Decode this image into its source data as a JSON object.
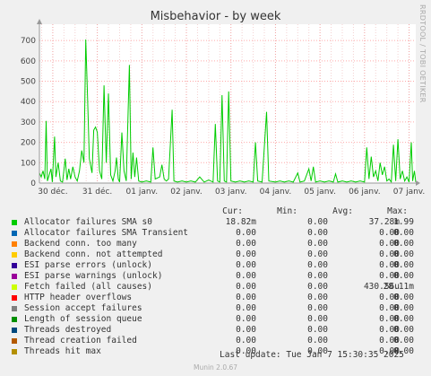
{
  "title": "Misbehavior - by week",
  "side_label": "RRDTOOL / TOBI OETIKER",
  "colors": {
    "series_line": "#00cc00",
    "grid": "#ffaaaa",
    "axis": "#999999"
  },
  "chart_data": {
    "type": "line",
    "title": "Misbehavior - by week",
    "ylim": [
      0,
      780
    ],
    "yticks": [
      0,
      100,
      200,
      300,
      400,
      500,
      600,
      700
    ],
    "xticks": [
      "30 déc.",
      "31 déc.",
      "01 janv.",
      "02 janv.",
      "03 janv.",
      "04 janv.",
      "05 janv.",
      "06 janv.",
      "07 janv."
    ],
    "xrange_days": [
      -0.3,
      8.15
    ],
    "grid": true,
    "series": [
      {
        "name": "Allocator failures SMA s0",
        "color": "#00cc00",
        "points": [
          [
            -0.3,
            50
          ],
          [
            -0.26,
            30
          ],
          [
            -0.22,
            60
          ],
          [
            -0.18,
            20
          ],
          [
            -0.15,
            305
          ],
          [
            -0.12,
            10
          ],
          [
            -0.08,
            40
          ],
          [
            -0.04,
            70
          ],
          [
            -0.01,
            5
          ],
          [
            0.04,
            228
          ],
          [
            0.07,
            30
          ],
          [
            0.12,
            100
          ],
          [
            0.17,
            10
          ],
          [
            0.22,
            5
          ],
          [
            0.28,
            120
          ],
          [
            0.32,
            15
          ],
          [
            0.36,
            70
          ],
          [
            0.4,
            20
          ],
          [
            0.45,
            80
          ],
          [
            0.5,
            30
          ],
          [
            0.55,
            10
          ],
          [
            0.6,
            60
          ],
          [
            0.65,
            160
          ],
          [
            0.7,
            100
          ],
          [
            0.74,
            705
          ],
          [
            0.78,
            425
          ],
          [
            0.82,
            120
          ],
          [
            0.88,
            50
          ],
          [
            0.92,
            260
          ],
          [
            0.96,
            275
          ],
          [
            1.0,
            250
          ],
          [
            1.05,
            60
          ],
          [
            1.1,
            20
          ],
          [
            1.15,
            480
          ],
          [
            1.2,
            100
          ],
          [
            1.25,
            440
          ],
          [
            1.3,
            40
          ],
          [
            1.35,
            10
          ],
          [
            1.4,
            60
          ],
          [
            1.43,
            125
          ],
          [
            1.47,
            20
          ],
          [
            1.5,
            5
          ],
          [
            1.55,
            248
          ],
          [
            1.6,
            60
          ],
          [
            1.65,
            10
          ],
          [
            1.72,
            580
          ],
          [
            1.76,
            20
          ],
          [
            1.8,
            150
          ],
          [
            1.84,
            30
          ],
          [
            1.88,
            125
          ],
          [
            1.93,
            10
          ],
          [
            2.0,
            5
          ],
          [
            2.1,
            10
          ],
          [
            2.2,
            5
          ],
          [
            2.25,
            175
          ],
          [
            2.3,
            20
          ],
          [
            2.4,
            30
          ],
          [
            2.45,
            90
          ],
          [
            2.5,
            20
          ],
          [
            2.55,
            10
          ],
          [
            2.6,
            20
          ],
          [
            2.68,
            360
          ],
          [
            2.72,
            10
          ],
          [
            2.8,
            5
          ],
          [
            2.9,
            10
          ],
          [
            3.0,
            5
          ],
          [
            3.1,
            10
          ],
          [
            3.2,
            5
          ],
          [
            3.3,
            30
          ],
          [
            3.4,
            5
          ],
          [
            3.5,
            15
          ],
          [
            3.6,
            5
          ],
          [
            3.65,
            290
          ],
          [
            3.7,
            10
          ],
          [
            3.75,
            5
          ],
          [
            3.8,
            432
          ],
          [
            3.85,
            10
          ],
          [
            3.9,
            5
          ],
          [
            3.95,
            450
          ],
          [
            4.0,
            10
          ],
          [
            4.1,
            5
          ],
          [
            4.2,
            10
          ],
          [
            4.3,
            5
          ],
          [
            4.4,
            10
          ],
          [
            4.5,
            5
          ],
          [
            4.55,
            200
          ],
          [
            4.6,
            10
          ],
          [
            4.7,
            5
          ],
          [
            4.8,
            350
          ],
          [
            4.85,
            10
          ],
          [
            5.0,
            5
          ],
          [
            5.1,
            10
          ],
          [
            5.2,
            5
          ],
          [
            5.3,
            10
          ],
          [
            5.4,
            5
          ],
          [
            5.5,
            50
          ],
          [
            5.55,
            5
          ],
          [
            5.65,
            10
          ],
          [
            5.75,
            70
          ],
          [
            5.8,
            10
          ],
          [
            5.85,
            80
          ],
          [
            5.9,
            5
          ],
          [
            6.0,
            10
          ],
          [
            6.1,
            5
          ],
          [
            6.2,
            10
          ],
          [
            6.3,
            5
          ],
          [
            6.35,
            45
          ],
          [
            6.4,
            5
          ],
          [
            6.5,
            10
          ],
          [
            6.6,
            5
          ],
          [
            6.7,
            10
          ],
          [
            6.8,
            5
          ],
          [
            6.9,
            10
          ],
          [
            7.0,
            5
          ],
          [
            7.05,
            175
          ],
          [
            7.1,
            20
          ],
          [
            7.15,
            130
          ],
          [
            7.2,
            30
          ],
          [
            7.25,
            60
          ],
          [
            7.3,
            10
          ],
          [
            7.35,
            100
          ],
          [
            7.4,
            40
          ],
          [
            7.45,
            80
          ],
          [
            7.5,
            10
          ],
          [
            7.55,
            20
          ],
          [
            7.6,
            5
          ],
          [
            7.65,
            188
          ],
          [
            7.7,
            10
          ],
          [
            7.75,
            215
          ],
          [
            7.8,
            20
          ],
          [
            7.85,
            60
          ],
          [
            7.9,
            10
          ],
          [
            7.95,
            30
          ],
          [
            8.0,
            5
          ],
          [
            8.05,
            200
          ],
          [
            8.08,
            10
          ],
          [
            8.12,
            60
          ],
          [
            8.15,
            5
          ]
        ]
      }
    ]
  },
  "legend": {
    "headers": {
      "cur": "Cur:",
      "min": "Min:",
      "avg": "Avg:",
      "max": "Max:"
    },
    "rows": [
      {
        "name": "Allocator failures SMA s0",
        "color": "#00cc00",
        "cur": "18.82m",
        "min": "0.00",
        "avg": "37.28m",
        "max": "1.99"
      },
      {
        "name": "Allocator failures SMA Transient",
        "color": "#0066b3",
        "cur": "0.00",
        "min": "0.00",
        "avg": "0.00",
        "max": "0.00"
      },
      {
        "name": "Backend conn. too many",
        "color": "#ff8000",
        "cur": "0.00",
        "min": "0.00",
        "avg": "0.00",
        "max": "0.00"
      },
      {
        "name": "Backend conn. not attempted",
        "color": "#ffcc00",
        "cur": "0.00",
        "min": "0.00",
        "avg": "0.00",
        "max": "0.00"
      },
      {
        "name": "ESI parse errors (unlock)",
        "color": "#330099",
        "cur": "0.00",
        "min": "0.00",
        "avg": "0.00",
        "max": "0.00"
      },
      {
        "name": "ESI parse warnings (unlock)",
        "color": "#990099",
        "cur": "0.00",
        "min": "0.00",
        "avg": "0.00",
        "max": "0.00"
      },
      {
        "name": "Fetch failed (all causes)",
        "color": "#ccff00",
        "cur": "0.00",
        "min": "0.00",
        "avg": "430.56u",
        "max": "28.11m"
      },
      {
        "name": "HTTP header overflows",
        "color": "#ff0000",
        "cur": "0.00",
        "min": "0.00",
        "avg": "0.00",
        "max": "0.00"
      },
      {
        "name": "Session accept failures",
        "color": "#808080",
        "cur": "0.00",
        "min": "0.00",
        "avg": "0.00",
        "max": "0.00"
      },
      {
        "name": "Length of session queue",
        "color": "#008f00",
        "cur": "0.00",
        "min": "0.00",
        "avg": "0.00",
        "max": "0.00"
      },
      {
        "name": "Threads destroyed",
        "color": "#00487d",
        "cur": "0.00",
        "min": "0.00",
        "avg": "0.00",
        "max": "0.00"
      },
      {
        "name": "Thread creation failed",
        "color": "#b35a00",
        "cur": "0.00",
        "min": "0.00",
        "avg": "0.00",
        "max": "0.00"
      },
      {
        "name": "Threads hit max",
        "color": "#b38f00",
        "cur": "0.00",
        "min": "0.00",
        "avg": "0.00",
        "max": "0.00"
      }
    ]
  },
  "last_update": "Last update: Tue Jan  7 15:30:35 2025",
  "footer": "Munin 2.0.67"
}
